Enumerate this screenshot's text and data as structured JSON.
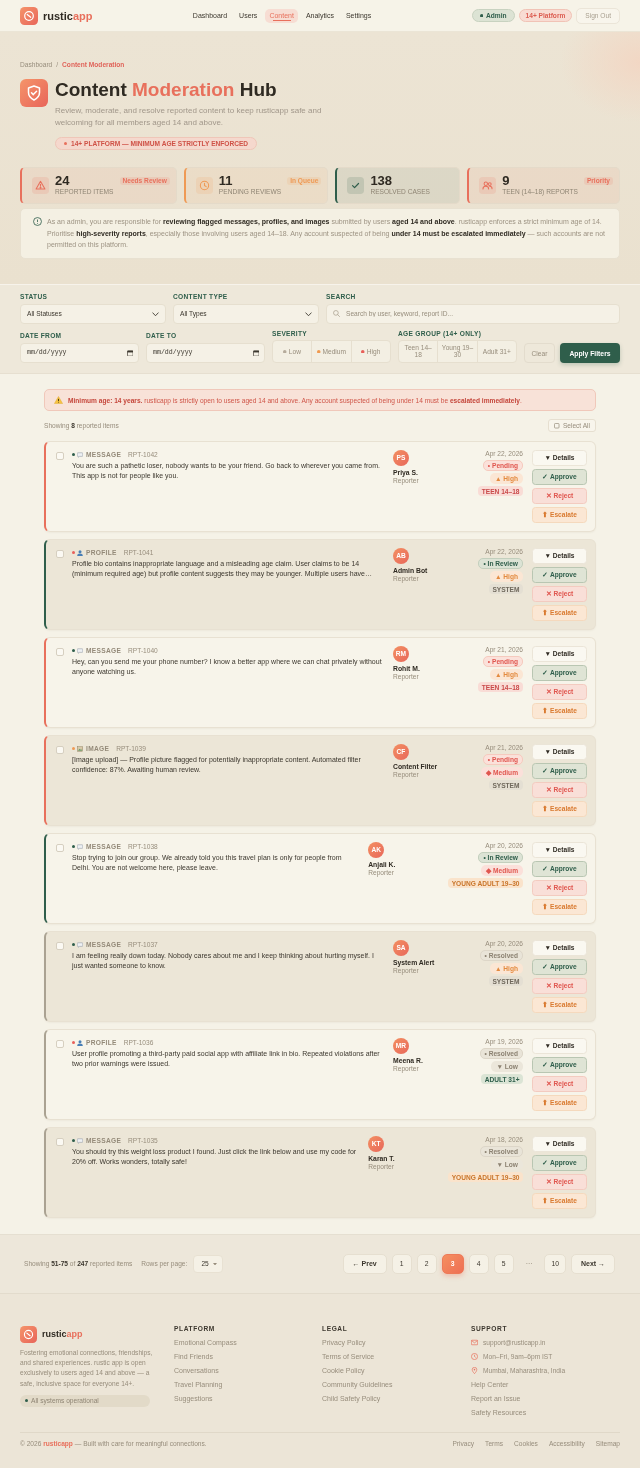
{
  "header": {
    "brand": {
      "name": "rustic",
      "accent": "app"
    },
    "nav": [
      {
        "label": "Dashboard",
        "selected": false
      },
      {
        "label": "Users",
        "selected": false
      },
      {
        "label": "Content",
        "selected": true
      },
      {
        "label": "Analytics",
        "selected": false
      },
      {
        "label": "Settings",
        "selected": false
      }
    ],
    "role_badge": "Admin",
    "platform_badge": "14+ Platform",
    "sign_out": "Sign Out"
  },
  "hero": {
    "breadcrumb": [
      {
        "label": "Dashboard",
        "selected": false
      },
      {
        "label": "Content Moderation",
        "selected": true
      }
    ],
    "breadcrumb_separator": "/",
    "title": {
      "before": "Content",
      "accent": "Moderation",
      "after": "Hub"
    },
    "subtitle": "Review, moderate, and resolve reported content to keep rusticapp safe and welcoming for all members aged 14 and above.",
    "age_badge": "14+ PLATFORM — MINIMUM AGE STRICTLY ENFORCED"
  },
  "stats": [
    {
      "kind": "alert",
      "value": "24",
      "label": "REPORTED ITEMS",
      "tag": "Needs Review",
      "color": "#e8705c"
    },
    {
      "kind": "pending",
      "value": "11",
      "label": "PENDING REVIEWS",
      "tag": "In Queue",
      "color": "#ef9a55"
    },
    {
      "kind": "resolved",
      "value": "138",
      "label": "RESOLVED CASES",
      "color": "#2f5e4b"
    },
    {
      "kind": "teen",
      "value": "9",
      "label": "TEEN (14–18) REPORTS",
      "tag": "Priority",
      "color": "#e8705c"
    }
  ],
  "notice": "As an admin, you are responsible for **reviewing flagged messages, profiles, and images** submitted by users **aged 14 and above**. rusticapp enforces a strict minimum age of 14. Prioritise **high-severity reports**, especially those involving users aged 14–18. Any account suspected of being **under 14 must be escalated immediately** — such accounts are not permitted on this platform.",
  "filters": {
    "status": {
      "label": "STATUS",
      "value": "All Statuses"
    },
    "content_type": {
      "label": "CONTENT TYPE",
      "value": "All Types"
    },
    "search": {
      "label": "SEARCH",
      "placeholder": "Search by user, keyword, report ID..."
    },
    "date_from": {
      "label": "DATE FROM",
      "placeholder": "mm/dd/yyyy"
    },
    "date_to": {
      "label": "DATE TO",
      "placeholder": "mm/dd/yyyy"
    },
    "severity": {
      "label": "SEVERITY",
      "options": [
        {
          "label": "Low",
          "selected": false,
          "color": "#b5ab9b"
        },
        {
          "label": "Medium",
          "selected": false,
          "color": "#f09a50"
        },
        {
          "label": "High",
          "selected": false,
          "color": "#e8605a"
        }
      ]
    },
    "age_group": {
      "label": "AGE GROUP (14+ ONLY)",
      "options": [
        {
          "label": "Teen 14–18",
          "selected": false
        },
        {
          "label": "Young 19–30",
          "selected": false
        },
        {
          "label": "Adult 31+",
          "selected": false
        }
      ]
    },
    "clear": "Clear",
    "apply": "Apply Filters"
  },
  "warning": "**Minimum age: 14 years.** rusticapp is strictly open to users aged 14 and above. Any account suspected of being under 14 must be **escalated immediately**.",
  "list": {
    "count": "Showing **8** reported items",
    "select_all": "Select All"
  },
  "reports": [
    {
      "checked": false,
      "kind": "message",
      "type_label": "MESSAGE",
      "id": "RPT-1042",
      "text": "You are such a pathetic loser, nobody wants to be your friend. Go back to wherever you came from. This app is not for people like you.",
      "reporter": {
        "initials": "PS",
        "name": "Priya S.",
        "role": "Reporter"
      },
      "date": "Apr 22, 2026",
      "status": {
        "label": "• Pending",
        "kind": "pending"
      },
      "severity": {
        "label": "▲ High",
        "kind": "high"
      },
      "audience": {
        "label": "TEEN 14–18",
        "kind": "teen"
      },
      "actions": [
        {
          "label": "▼ Details",
          "kind": "details"
        },
        {
          "label": "✓ Approve",
          "kind": "approve"
        },
        {
          "label": "✕ Reject",
          "kind": "reject"
        },
        {
          "label": "⬆ Escalate",
          "kind": "escalate"
        }
      ]
    },
    {
      "checked": false,
      "kind": "profile",
      "type_label": "PROFILE",
      "id": "RPT-1041",
      "text": "Profile bio contains inappropriate language and a misleading age claim. User claims to be 14 (minimum required age) but profile content suggests they may be younger. Multiple users have…",
      "reporter": {
        "initials": "AB",
        "name": "Admin Bot",
        "role": "Reporter"
      },
      "date": "Apr 22, 2026",
      "status": {
        "label": "• In Review",
        "kind": "review"
      },
      "severity": {
        "label": "▲ High",
        "kind": "high"
      },
      "audience": {
        "label": "SYSTEM",
        "kind": "system"
      },
      "actions": [
        {
          "label": "▼ Details",
          "kind": "details"
        },
        {
          "label": "✓ Approve",
          "kind": "approve"
        },
        {
          "label": "✕ Reject",
          "kind": "reject"
        },
        {
          "label": "⬆ Escalate",
          "kind": "escalate"
        }
      ]
    },
    {
      "checked": false,
      "kind": "message",
      "type_label": "MESSAGE",
      "id": "RPT-1040",
      "text": "Hey, can you send me your phone number? I know a better app where we can chat privately without anyone watching us.",
      "reporter": {
        "initials": "RM",
        "name": "Rohit M.",
        "role": "Reporter"
      },
      "date": "Apr 21, 2026",
      "status": {
        "label": "• Pending",
        "kind": "pending"
      },
      "severity": {
        "label": "▲ High",
        "kind": "high"
      },
      "audience": {
        "label": "TEEN 14–18",
        "kind": "teen"
      },
      "actions": [
        {
          "label": "▼ Details",
          "kind": "details"
        },
        {
          "label": "✓ Approve",
          "kind": "approve"
        },
        {
          "label": "✕ Reject",
          "kind": "reject"
        },
        {
          "label": "⬆ Escalate",
          "kind": "escalate"
        }
      ]
    },
    {
      "checked": false,
      "kind": "image",
      "type_label": "IMAGE",
      "id": "RPT-1039",
      "text": "[Image upload] — Profile picture flagged for potentially inappropriate content. Automated filter confidence: 87%. Awaiting human review.",
      "reporter": {
        "initials": "CF",
        "name": "Content Filter",
        "role": "Reporter"
      },
      "date": "Apr 21, 2026",
      "status": {
        "label": "• Pending",
        "kind": "pending"
      },
      "severity": {
        "label": "◆ Medium",
        "kind": "medium"
      },
      "audience": {
        "label": "SYSTEM",
        "kind": "system"
      },
      "actions": [
        {
          "label": "▼ Details",
          "kind": "details"
        },
        {
          "label": "✓ Approve",
          "kind": "approve"
        },
        {
          "label": "✕ Reject",
          "kind": "reject"
        },
        {
          "label": "⬆ Escalate",
          "kind": "escalate"
        }
      ]
    },
    {
      "checked": false,
      "kind": "message",
      "type_label": "MESSAGE",
      "id": "RPT-1038",
      "text": "Stop trying to join our group. We already told you this travel plan is only for people from Delhi. You are not welcome here, please leave.",
      "reporter": {
        "initials": "AK",
        "name": "Anjali K.",
        "role": "Reporter"
      },
      "date": "Apr 20, 2026",
      "status": {
        "label": "• In Review",
        "kind": "review"
      },
      "severity": {
        "label": "◆ Medium",
        "kind": "medium"
      },
      "audience": {
        "label": "YOUNG ADULT 19–30",
        "kind": "young"
      },
      "actions": [
        {
          "label": "▼ Details",
          "kind": "details"
        },
        {
          "label": "✓ Approve",
          "kind": "approve"
        },
        {
          "label": "✕ Reject",
          "kind": "reject"
        },
        {
          "label": "⬆ Escalate",
          "kind": "escalate"
        }
      ]
    },
    {
      "checked": false,
      "kind": "message",
      "type_label": "MESSAGE",
      "id": "RPT-1037",
      "text": "I am feeling really down today. Nobody cares about me and I keep thinking about hurting myself. I just wanted someone to know.",
      "reporter": {
        "initials": "SA",
        "name": "System Alert",
        "role": "Reporter"
      },
      "date": "Apr 20, 2026",
      "status": {
        "label": "• Resolved",
        "kind": "resolved"
      },
      "severity": {
        "label": "▲ High",
        "kind": "high"
      },
      "audience": {
        "label": "SYSTEM",
        "kind": "system"
      },
      "actions": [
        {
          "label": "▼ Details",
          "kind": "details"
        },
        {
          "label": "✓ Approve",
          "kind": "approve"
        },
        {
          "label": "✕ Reject",
          "kind": "reject"
        },
        {
          "label": "⬆ Escalate",
          "kind": "escalate"
        }
      ]
    },
    {
      "checked": false,
      "kind": "profile",
      "type_label": "PROFILE",
      "id": "RPT-1036",
      "text": "User profile promoting a third-party paid social app with affiliate link in bio. Repeated violations after two prior warnings were issued.",
      "reporter": {
        "initials": "MR",
        "name": "Meena R.",
        "role": "Reporter"
      },
      "date": "Apr 19, 2026",
      "status": {
        "label": "• Resolved",
        "kind": "resolved"
      },
      "severity": {
        "label": "▼ Low",
        "kind": "low"
      },
      "audience": {
        "label": "ADULT 31+",
        "kind": "adult"
      },
      "actions": [
        {
          "label": "▼ Details",
          "kind": "details"
        },
        {
          "label": "✓ Approve",
          "kind": "approve"
        },
        {
          "label": "✕ Reject",
          "kind": "reject"
        },
        {
          "label": "⬆ Escalate",
          "kind": "escalate"
        }
      ]
    },
    {
      "checked": false,
      "kind": "message",
      "type_label": "MESSAGE",
      "id": "RPT-1035",
      "text": "You should try this weight loss product I found. Just click the link below and use my code for 20% off. Works wonders, totally safe!",
      "reporter": {
        "initials": "KT",
        "name": "Karan T.",
        "role": "Reporter"
      },
      "date": "Apr 18, 2026",
      "status": {
        "label": "• Resolved",
        "kind": "resolved"
      },
      "severity": {
        "label": "▼ Low",
        "kind": "low"
      },
      "audience": {
        "label": "YOUNG ADULT 19–30",
        "kind": "young"
      },
      "actions": [
        {
          "label": "▼ Details",
          "kind": "details"
        },
        {
          "label": "✓ Approve",
          "kind": "approve"
        },
        {
          "label": "✕ Reject",
          "kind": "reject"
        },
        {
          "label": "⬆ Escalate",
          "kind": "escalate"
        }
      ]
    }
  ],
  "pagination": {
    "summary": "Showing **51-75** of **247** reported items",
    "rows_label": "Rows per page:",
    "rows_value": "25",
    "prev": "← Prev",
    "next": "Next →",
    "pages": [
      {
        "label": "1",
        "kind": "page",
        "selected": false
      },
      {
        "label": "2",
        "kind": "page",
        "selected": false
      },
      {
        "label": "3",
        "kind": "page",
        "selected": true
      },
      {
        "label": "4",
        "kind": "page",
        "selected": false
      },
      {
        "label": "5",
        "kind": "page",
        "selected": false
      },
      {
        "label": "···",
        "kind": "gap",
        "selected": false
      },
      {
        "label": "10",
        "kind": "page",
        "selected": false
      }
    ]
  },
  "footer": {
    "brand": {
      "name": "rustic",
      "accent": "app"
    },
    "description": "Fostering emotional connections, friendships, and shared experiences. rustic app is open exclusively to users aged 14 and above — a safe, inclusive space for everyone 14+.",
    "system_status": "All systems operational",
    "columns": [
      {
        "title": "PLATFORM",
        "items": [
          {
            "kind": "link",
            "label": "Emotional Compass"
          },
          {
            "kind": "link",
            "label": "Find Friends"
          },
          {
            "kind": "link",
            "label": "Conversations"
          },
          {
            "kind": "link",
            "label": "Travel Planning"
          },
          {
            "kind": "link",
            "label": "Suggestions"
          }
        ]
      },
      {
        "title": "LEGAL",
        "items": [
          {
            "kind": "link",
            "label": "Privacy Policy"
          },
          {
            "kind": "link",
            "label": "Terms of Service"
          },
          {
            "kind": "link",
            "label": "Cookie Policy"
          },
          {
            "kind": "link",
            "label": "Community Guidelines"
          },
          {
            "kind": "link",
            "label": "Child Safety Policy"
          }
        ]
      },
      {
        "title": "SUPPORT",
        "items": [
          {
            "kind": "email",
            "label": "support@rusticapp.in"
          },
          {
            "kind": "hours",
            "label": "Mon–Fri, 9am–6pm IST"
          },
          {
            "kind": "location",
            "label": "Mumbai, Maharashtra, India"
          },
          {
            "kind": "link",
            "label": "Help Center"
          },
          {
            "kind": "link",
            "label": "Report an Issue"
          },
          {
            "kind": "link",
            "label": "Safety Resources"
          }
        ]
      }
    ],
    "copyright": "© 2026 **rusticapp** — Built with care for meaningful connections.",
    "bottom_links": [
      "Privacy",
      "Terms",
      "Cookies",
      "Accessibility",
      "Sitemap"
    ]
  }
}
